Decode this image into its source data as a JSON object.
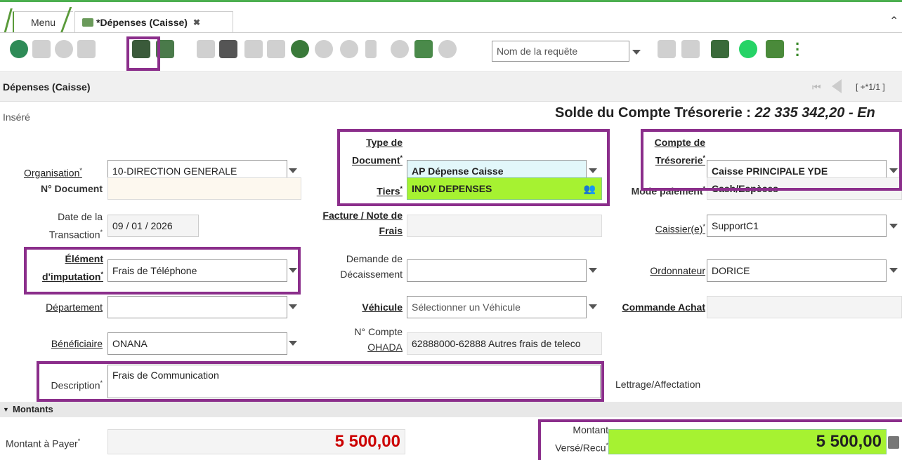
{
  "tabs": {
    "menu": "Menu",
    "active": "*Dépenses (Caisse)",
    "close": "✖"
  },
  "toolbar": {
    "query_placeholder": "Nom de la requête"
  },
  "header": {
    "title": "Dépenses (Caisse)",
    "pager": "[ +*1/1 ]"
  },
  "status": {
    "state": "Inséré",
    "balance_label": "Solde du Compte Trésorerie :",
    "balance_value": "22 335 342,20 - En"
  },
  "form": {
    "organisation_label": "Organisation",
    "organisation": "10-DIRECTION GENERALE",
    "doc_type_label_1": "Type de",
    "doc_type_label_2": "Document",
    "doc_type": "AP Dépense Caisse",
    "treso_label_1": "Compte de",
    "treso_label_2": "Trésorerie",
    "treso": "Caisse PRINCIPALE YDE",
    "ndoc_label": "N° Document",
    "ndoc": "",
    "tiers_label": "Tiers",
    "tiers": "INOV DEPENSES",
    "mode_label": "Mode paiement",
    "mode": "Cash/Espèces",
    "date_label_1": "Date de la",
    "date_label_2": "Transaction",
    "date": "09 / 01 / 2026",
    "facture_label_1": "Facture / Note de",
    "facture_label_2": "Frais",
    "facture": "",
    "caissier_label": "Caissier(e)",
    "caissier": "SupportC1",
    "element_label_1": "Élément",
    "element_label_2": "d'imputation",
    "element": "Frais de Téléphone",
    "demande_label_1": "Demande de",
    "demande_label_2": "Décaissement",
    "demande": "",
    "ordonnateur_label": "Ordonnateur",
    "ordonnateur": "DORICE",
    "departement_label": "Département",
    "departement": "",
    "vehicule_label": "Véhicule",
    "vehicule": "Sélectionner un Véhicule",
    "commande_label": "Commande Achat",
    "commande": "",
    "beneficiaire_label": "Bénéficiaire",
    "beneficiaire": "ONANA",
    "ohada_label_1": "N° Compte",
    "ohada_label_2": "OHADA",
    "ohada": "62888000-62888 Autres frais de teleco",
    "description_label": "Description",
    "description": "Frais de Communication",
    "lettrage_label": "Lettrage/Affectation"
  },
  "montants": {
    "section": "Montants",
    "a_payer_label": "Montant à Payer",
    "a_payer": "5 500,00",
    "verse_label_1": "Montant",
    "verse_label_2": "Versé/Recu",
    "verse": "5 500,00"
  },
  "colors": {
    "highlight": "#8b2e8b",
    "green_field": "#a6f231",
    "amount_red": "#cc0000"
  }
}
